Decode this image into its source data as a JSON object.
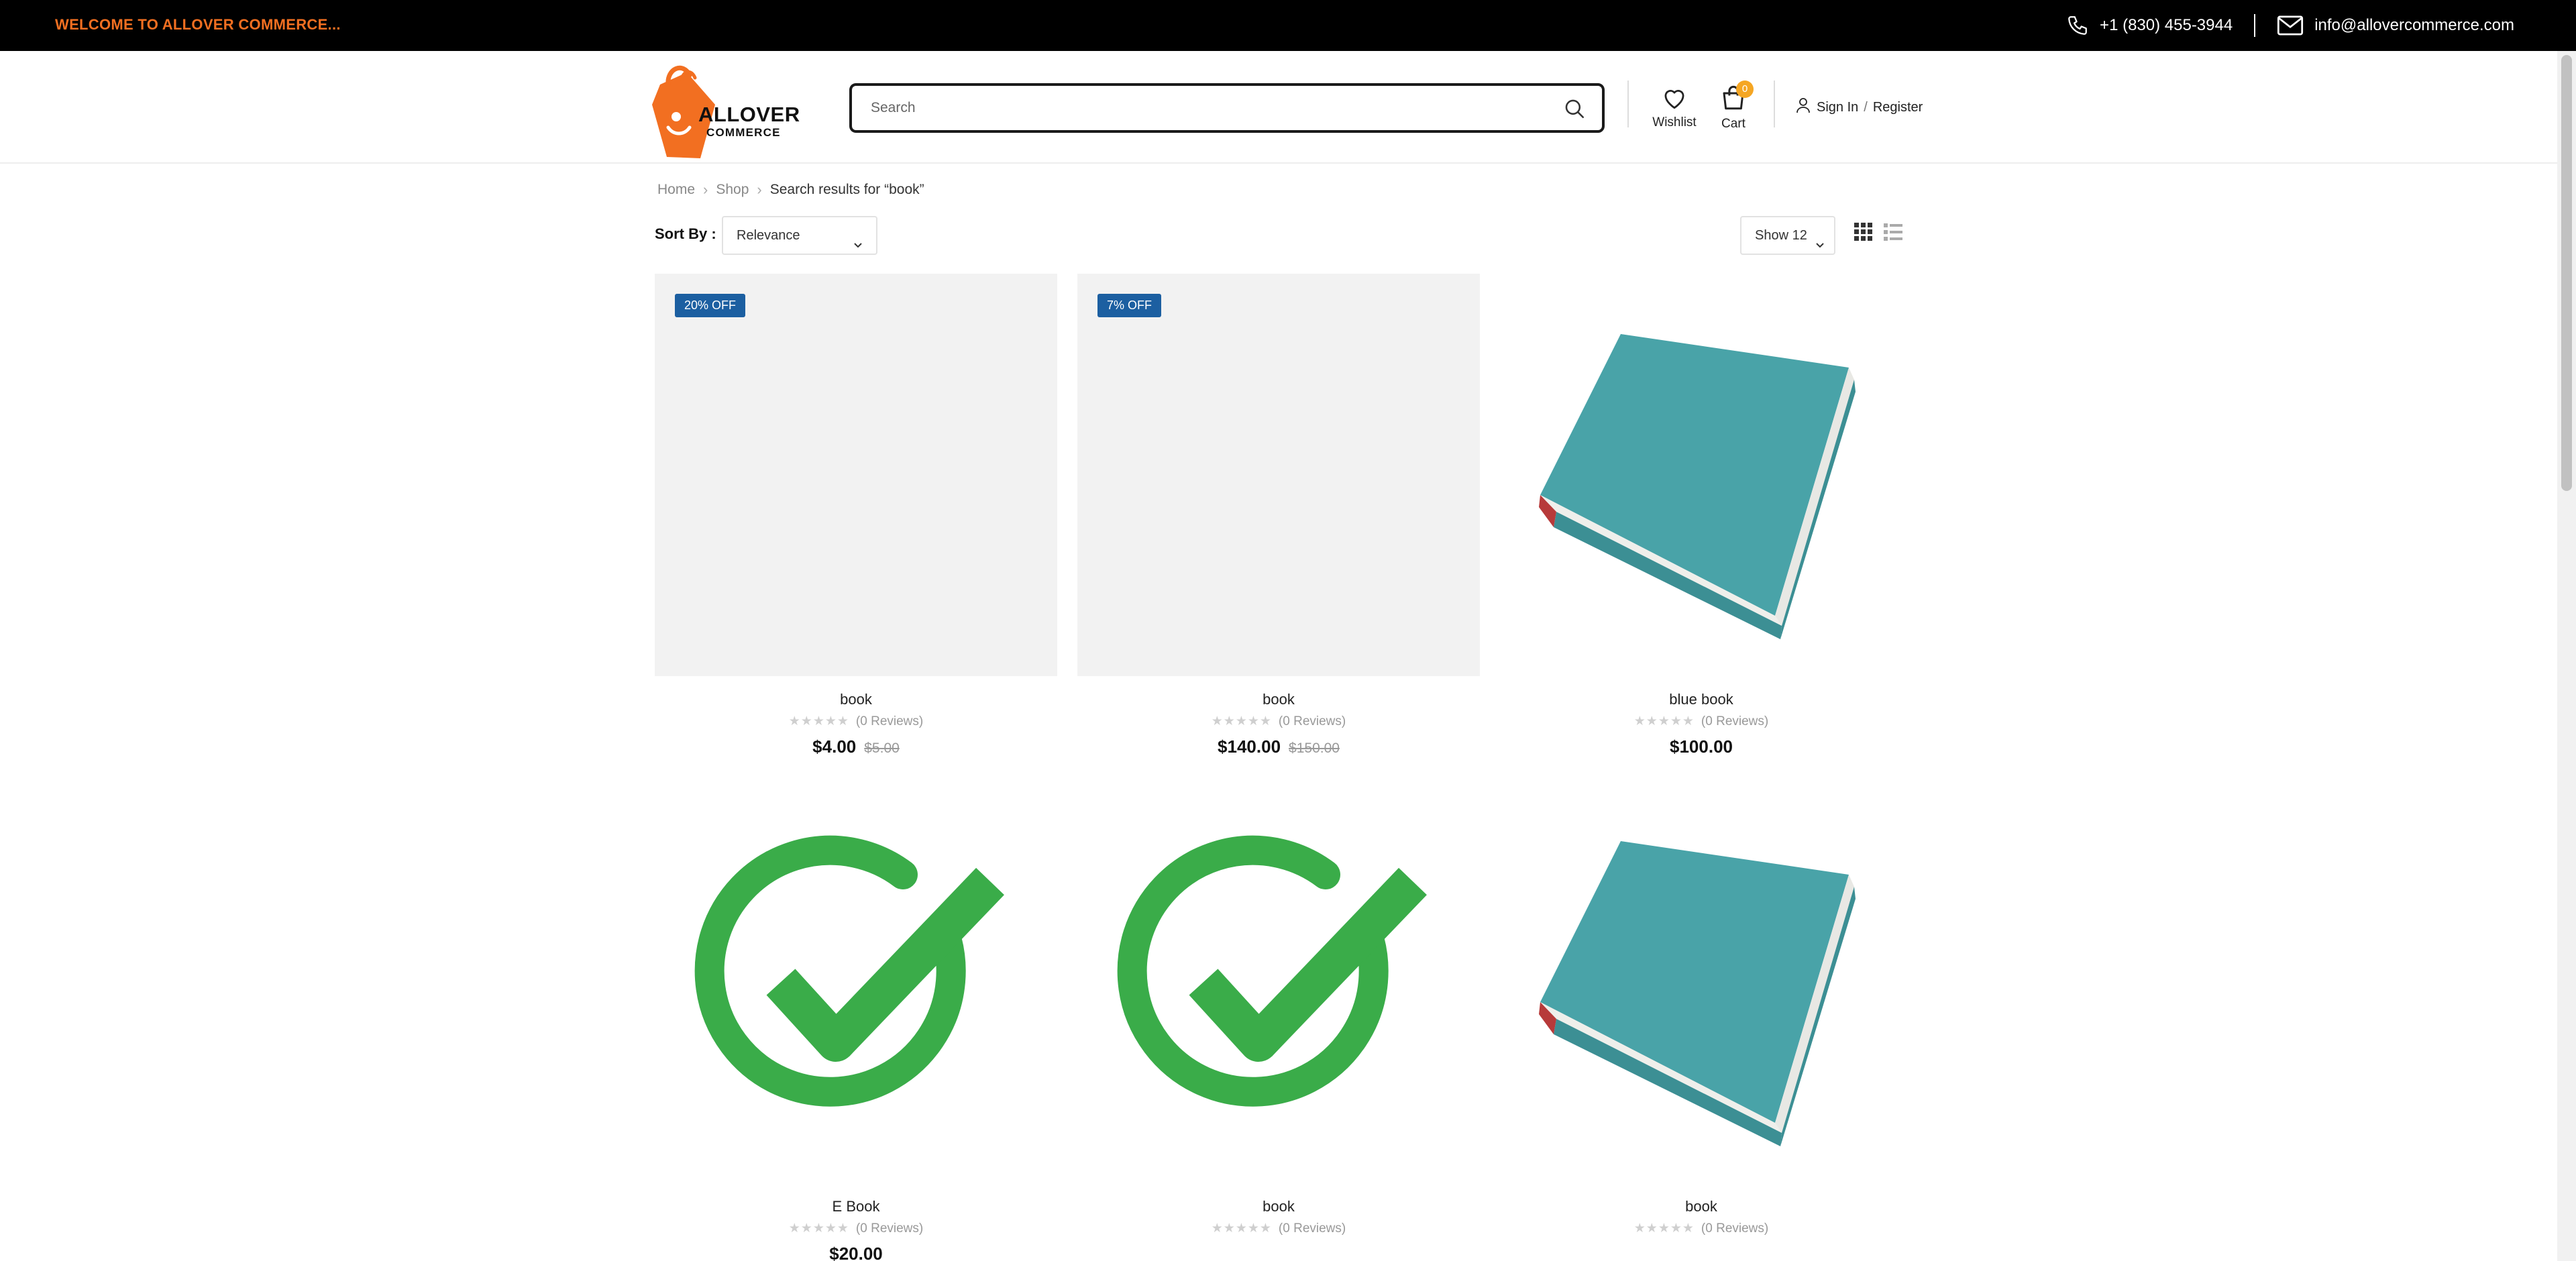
{
  "topbar": {
    "welcome": "WELCOME TO ALLOVER COMMERCE...",
    "phone": "+1 (830) 455-3944",
    "email": "info@allovercommerce.com"
  },
  "header": {
    "logo_line1": "ALLOVER",
    "logo_line2": "COMMERCE",
    "search_placeholder": "Search",
    "wishlist_label": "Wishlist",
    "cart_label": "Cart",
    "cart_count": "0",
    "signin_label": "Sign In",
    "separator": "/",
    "register_label": "Register"
  },
  "breadcrumb": {
    "items": [
      "Home",
      "Shop"
    ],
    "current": "Search results for “book”"
  },
  "toolbar": {
    "sort_label": "Sort By :",
    "sort_value": "Relevance",
    "show_value": "Show 12"
  },
  "products": [
    {
      "name": "book",
      "badge": "20% OFF",
      "reviews": "(0 Reviews)",
      "price": "$4.00",
      "old_price": "$5.00",
      "image": "none"
    },
    {
      "name": "book",
      "badge": "7% OFF",
      "reviews": "(0 Reviews)",
      "price": "$140.00",
      "old_price": "$150.00",
      "image": "none"
    },
    {
      "name": "blue book",
      "badge": "",
      "reviews": "(0 Reviews)",
      "price": "$100.00",
      "old_price": "",
      "image": "teal-book"
    },
    {
      "name": "E Book",
      "badge": "",
      "reviews": "(0 Reviews)",
      "price": "$20.00",
      "old_price": "",
      "image": "green-check"
    },
    {
      "name": "book",
      "badge": "",
      "reviews": "(0 Reviews)",
      "price": "",
      "old_price": "",
      "image": "green-check"
    },
    {
      "name": "book",
      "badge": "",
      "reviews": "(0 Reviews)",
      "price": "",
      "old_price": "",
      "image": "teal-book"
    }
  ],
  "colors": {
    "brand_orange": "#f26f21",
    "badge_blue": "#1c5fa1",
    "cart_badge": "#f5a623",
    "check_green": "#3aac49",
    "book_teal": "#4aa3a8"
  },
  "icons": [
    "phone-icon",
    "mail-icon",
    "search-icon",
    "heart-icon",
    "cart-icon",
    "user-icon",
    "grid-view-icon",
    "list-view-icon",
    "chevron-down-icon"
  ]
}
